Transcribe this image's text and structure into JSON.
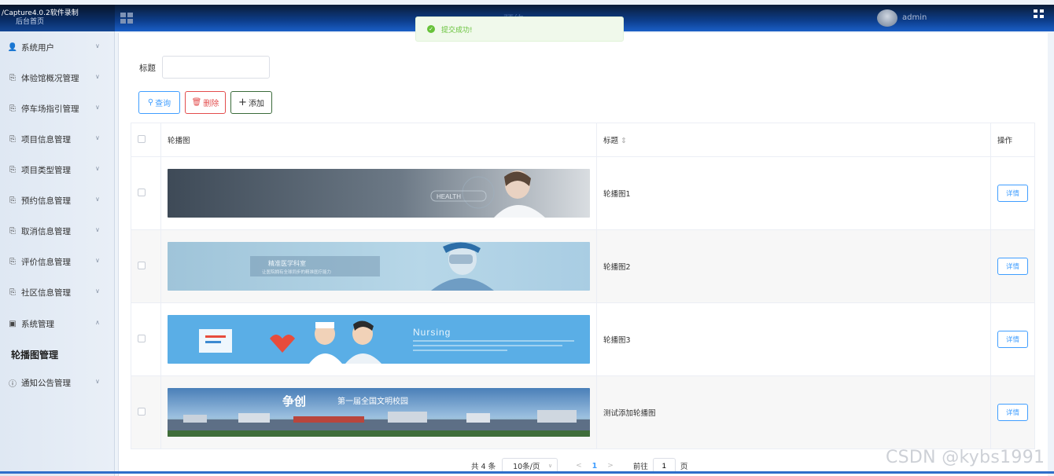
{
  "recorder_caption": "/Capture4.0.2软件录制",
  "header": {
    "home_label": "后台首页",
    "title": "预约",
    "user": "admin"
  },
  "toast": {
    "message": "提交成功!"
  },
  "sidebar": {
    "items": [
      {
        "label": "系统用户",
        "icon": "user-icon",
        "chevron": "chevron-down-icon"
      },
      {
        "label": "体验馆概况管理",
        "icon": "document-icon",
        "chevron": "chevron-down-icon"
      },
      {
        "label": "停车场指引管理",
        "icon": "document-icon",
        "chevron": "chevron-down-icon"
      },
      {
        "label": "项目信息管理",
        "icon": "document-icon",
        "chevron": "chevron-down-icon"
      },
      {
        "label": "项目类型管理",
        "icon": "document-icon",
        "chevron": "chevron-down-icon"
      },
      {
        "label": "预约信息管理",
        "icon": "document-icon",
        "chevron": "chevron-down-icon"
      },
      {
        "label": "取消信息管理",
        "icon": "document-icon",
        "chevron": "chevron-down-icon"
      },
      {
        "label": "评价信息管理",
        "icon": "document-icon",
        "chevron": "chevron-down-icon"
      },
      {
        "label": "社区信息管理",
        "icon": "document-icon",
        "chevron": "chevron-down-icon"
      },
      {
        "label": "系统管理",
        "icon": "picture-icon",
        "chevron": "chevron-up-icon"
      },
      {
        "label": "通知公告管理",
        "icon": "info-icon",
        "chevron": "chevron-down-icon"
      }
    ],
    "active_sub_item": "轮播图管理"
  },
  "search": {
    "label": "标题",
    "value": "",
    "placeholder": ""
  },
  "toolbar": {
    "query": "查询",
    "delete": "删除",
    "add": "添加"
  },
  "table": {
    "headers": {
      "image": "轮播图",
      "title": "标题",
      "action": "操作"
    },
    "rows": [
      {
        "title": "轮播图1",
        "action": "详情",
        "image_text": "HEALTH"
      },
      {
        "title": "轮播图2",
        "action": "详情",
        "image_text": "精准医学科室",
        "image_subtext": "让医院拥有全球同步的精准医疗能力"
      },
      {
        "title": "轮播图3",
        "action": "详情",
        "image_text": "Nursing"
      },
      {
        "title": "测试添加轮播图",
        "action": "详情",
        "image_text": "争创",
        "image_subtext": "第一届全国文明校园"
      }
    ]
  },
  "pagination": {
    "total": "共 4 条",
    "page_size": "10条/页",
    "current_page": "1",
    "goto_label": "前往",
    "jump_value": "1",
    "page_suffix": "页"
  },
  "watermark": "CSDN @kybs1991",
  "colors": {
    "primary": "#409eff",
    "danger": "#e34d4d",
    "success": "#67c23a",
    "header": "#0d3e8c"
  }
}
